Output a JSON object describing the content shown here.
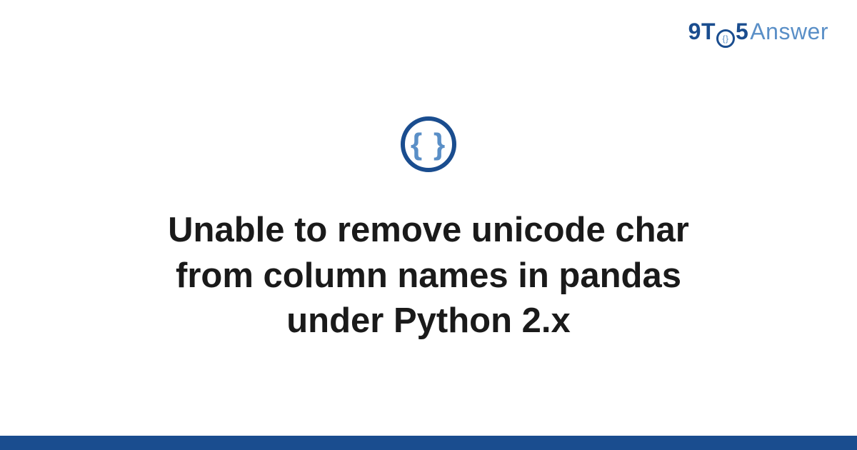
{
  "logo": {
    "part1": "9T",
    "part2_inner": "{}",
    "part3": "5",
    "part4": "Answer"
  },
  "icon": {
    "symbol": "{ }",
    "name": "code-braces-icon"
  },
  "title": "Unable to remove unicode char from column names in pandas under Python 2.x"
}
